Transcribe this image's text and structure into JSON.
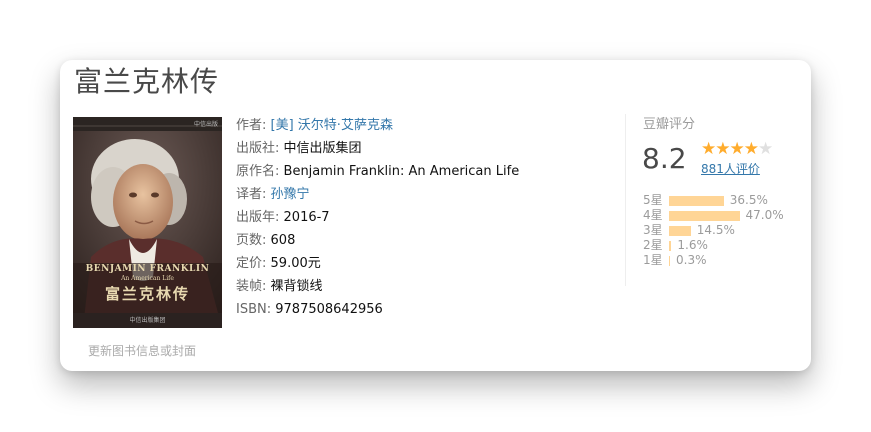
{
  "book": {
    "title": "富兰克林传",
    "cover": {
      "header_text": "中信出版",
      "title_en": "BENJAMIN FRANKLIN",
      "subtitle_en": "An American Life",
      "title_zh": "富兰克林传",
      "publisher_footer": "中信出版集团"
    },
    "update_link": "更新图书信息或封面"
  },
  "info": {
    "author_label": "作者:",
    "author_value": "[美] 沃尔特·艾萨克森",
    "publisher_label": "出版社:",
    "publisher_value": "中信出版集团",
    "original_title_label": "原作名:",
    "original_title_value": "Benjamin Franklin: An American Life",
    "translator_label": "译者:",
    "translator_value": "孙豫宁",
    "pub_year_label": "出版年:",
    "pub_year_value": "2016-7",
    "pages_label": "页数:",
    "pages_value": "608",
    "price_label": "定价:",
    "price_value": "59.00元",
    "binding_label": "装帧:",
    "binding_value": "裸背锁线",
    "isbn_label": "ISBN:",
    "isbn_value": "9787508642956"
  },
  "rating": {
    "title": "豆瓣评分",
    "score": "8.2",
    "stars_filled": 4,
    "stars_total": 5,
    "votes": "881人评价",
    "distribution": [
      {
        "label": "5星",
        "percent": 36.5,
        "text": "36.5%"
      },
      {
        "label": "4星",
        "percent": 47.0,
        "text": "47.0%"
      },
      {
        "label": "3星",
        "percent": 14.5,
        "text": "14.5%"
      },
      {
        "label": "2星",
        "percent": 1.6,
        "text": "1.6%"
      },
      {
        "label": "1星",
        "percent": 0.3,
        "text": "0.3%"
      }
    ]
  },
  "colors": {
    "link": "#3377aa",
    "star_filled": "#ffac2d",
    "star_empty": "#e0e0e0",
    "bar": "#ffd596"
  }
}
